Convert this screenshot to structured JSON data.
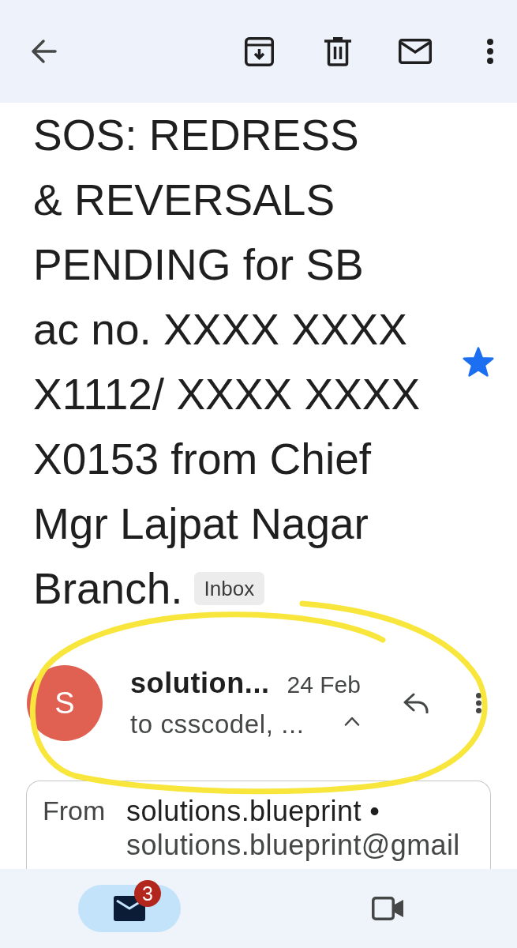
{
  "message": {
    "subject": "SOS: REDRESS\n& REVERSALS\nPENDING for SB\nac no. XXXX XXXX\nX1112/ XXXX XXXX\nX0153 from Chief\nMgr Lajpat Nagar\nBranch.",
    "label": "Inbox",
    "starred": true
  },
  "sender": {
    "avatar_letter": "S",
    "name": "solution...",
    "date": "24 Feb",
    "recipients": "to csscodel, ...",
    "expanded": true
  },
  "details": {
    "from_label": "From",
    "from_name": "solutions.blueprint •",
    "from_address": "solutions.blueprint@gmail"
  },
  "bottom_nav": [
    {
      "kind": "mail",
      "selected": true,
      "badge": "3"
    },
    {
      "kind": "video",
      "selected": false
    }
  ],
  "annotation": {
    "kind": "loop"
  }
}
